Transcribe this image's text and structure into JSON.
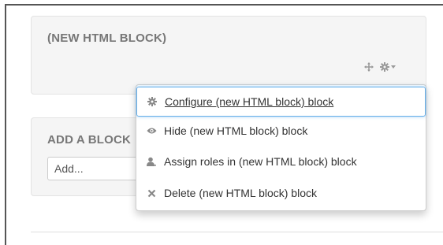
{
  "html_block": {
    "title": "(NEW HTML BLOCK)",
    "controls": {
      "move_icon": "move-icon",
      "gear_icon": "gear-icon",
      "caret_icon": "caret-down-icon"
    }
  },
  "add_block": {
    "title": "ADD A BLOCK",
    "select_value": "Add..."
  },
  "action_menu": {
    "items": [
      {
        "label": "Configure (new HTML block) block",
        "icon": "gear-icon",
        "active": true
      },
      {
        "label": "Hide (new HTML block) block",
        "icon": "eye-icon",
        "active": false
      },
      {
        "label": "Assign roles in (new HTML block) block",
        "icon": "user-icon",
        "active": false
      },
      {
        "label": "Delete (new HTML block) block",
        "icon": "delete-x-icon",
        "active": false
      }
    ]
  },
  "colors": {
    "block_background": "#f5f5f5",
    "title_text": "#777777",
    "menu_text": "#333333",
    "focus_border": "#66afe9"
  }
}
